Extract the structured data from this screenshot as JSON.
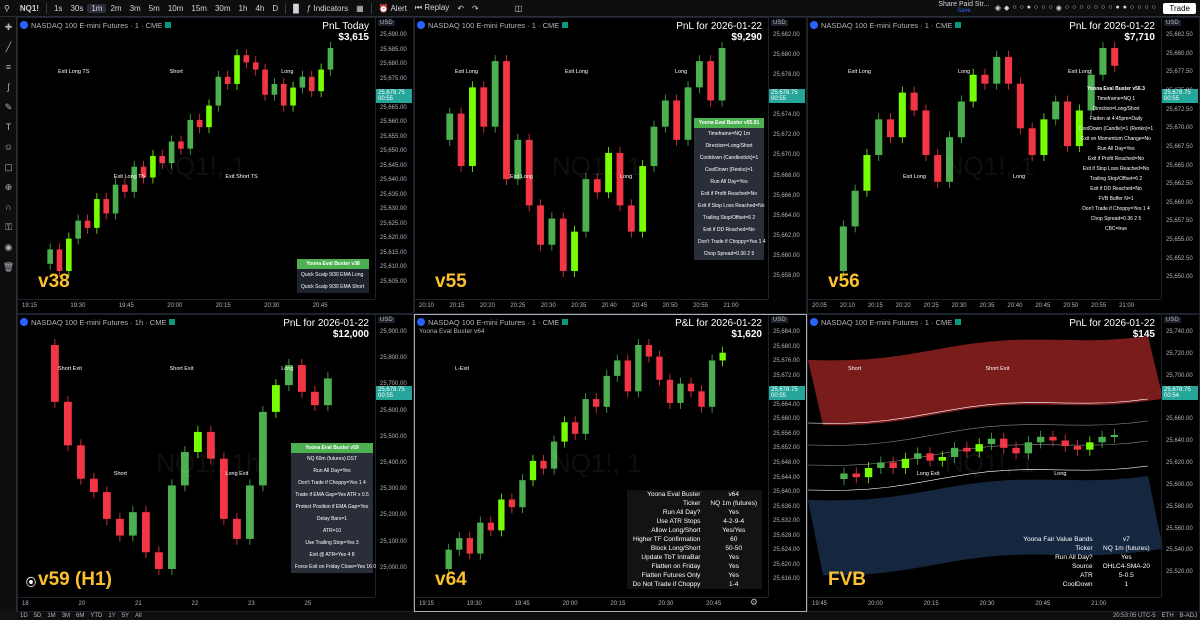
{
  "toolbar": {
    "symbol": "NQ1!",
    "intervals": [
      "1s",
      "30s",
      "1m",
      "2m",
      "3m",
      "5m",
      "10m",
      "15m",
      "30m",
      "1h",
      "4h",
      "D"
    ],
    "active_interval": "1m",
    "indicators": "Indicators",
    "alert": "Alert",
    "replay": "Replay",
    "share_line1": "Share Paid Str...",
    "share_line2": "Save",
    "trade": "Trade"
  },
  "bottom": {
    "ranges": [
      "1D",
      "5D",
      "1M",
      "3M",
      "6M",
      "YTD",
      "1Y",
      "5Y",
      "All"
    ],
    "clock": "20:53:05 UTC-5",
    "session": "ETH",
    "adj": "B-ADJ"
  },
  "panels": [
    {
      "id": "p1",
      "title": "NASDAQ 100 E-mini Futures · 1 · CME",
      "currency": "USD",
      "pnl_label": "PnL Today",
      "pnl_value": "$3,615",
      "version": "v38",
      "watermark": "NQ1!, 1",
      "yticks": [
        "25,690.00",
        "25,685.00",
        "25,680.00",
        "25,675.00",
        "25,670.00",
        "25,665.00",
        "25,660.00",
        "25,655.00",
        "25,650.00",
        "25,645.00",
        "25,640.00",
        "25,635.00",
        "25,630.00",
        "25,625.00",
        "25,620.00",
        "25,615.00",
        "25,610.00",
        "25,605.00"
      ],
      "price": "25,678.75",
      "countdown": "00:55",
      "xticks": [
        "19:15",
        "19:30",
        "19:45",
        "20:00",
        "20:15",
        "20:30",
        "20:45"
      ],
      "table": {
        "header": "Yoona Eval Buster v38",
        "rows": [
          "Quick Scalp 9/30 EMA Long",
          "Quick Scalp 9/30 EMA Short"
        ]
      },
      "labels": [
        {
          "t": "Exit Long TS",
          "k": "exit"
        },
        {
          "t": "Exit Long TS",
          "k": "exit"
        },
        {
          "t": "Short",
          "k": "short"
        },
        {
          "t": "Exit Short TS",
          "k": "exit"
        },
        {
          "t": "Long",
          "k": "long"
        }
      ]
    },
    {
      "id": "p2",
      "title": "NASDAQ 100 E-mini Futures · 1 · CME",
      "currency": "USD",
      "pnl_label": "PnL for 2026-01-22",
      "pnl_value": "$9,290",
      "version": "v55",
      "watermark": "NQ1!, 1",
      "yticks": [
        "25,682.00",
        "25,680.00",
        "25,678.00",
        "25,676.00",
        "25,674.00",
        "25,672.00",
        "25,670.00",
        "25,668.00",
        "25,666.00",
        "25,664.00",
        "25,662.00",
        "25,660.00",
        "25,658.00"
      ],
      "price": "25,678.75",
      "countdown": "00:55",
      "xticks": [
        "20:10",
        "20:15",
        "20:20",
        "20:25",
        "20:30",
        "20:35",
        "20:40",
        "20:45",
        "20:50",
        "20:55",
        "21:00"
      ],
      "table": {
        "header": "Yoona Eval Buster v55.91",
        "rows": [
          "Timeframe=NQ 1m",
          "Direction=Long/Short",
          "Cooldown (Candlestick)=1",
          "CoolDown (Renko)=1",
          "Run All Day=Yes",
          "Exit if Profit Reached=No",
          "Exit if Stop Loss Reached=No",
          "Trailing Stop/Offset=6 2",
          "Exit if DD Reached=No",
          "Don't Trade if Choppy=Yes 1 4",
          "Chop Spread=0.36 2 5"
        ]
      },
      "labels": [
        {
          "t": "Exit Long",
          "k": "exit"
        },
        {
          "t": "Exit Long",
          "k": "exit"
        },
        {
          "t": "Exit Long",
          "k": "exit"
        },
        {
          "t": "Long",
          "k": "long"
        },
        {
          "t": "Long",
          "k": "long"
        }
      ]
    },
    {
      "id": "p3",
      "title": "NASDAQ 100 E-mini Futures · 1 · CME",
      "currency": "USD",
      "pnl_label": "PnL for 2026-01-22",
      "pnl_value": "$7,710",
      "version": "v56",
      "watermark": "NQ1!, 1",
      "yticks": [
        "25,682.50",
        "25,680.00",
        "25,677.50",
        "25,675.00",
        "25,672.50",
        "25,670.00",
        "25,667.50",
        "25,665.00",
        "25,662.50",
        "25,660.00",
        "25,657.50",
        "25,655.00",
        "25,652.50",
        "25,650.00"
      ],
      "price": "25,678.75",
      "countdown": "00:55",
      "xticks": [
        "20:05",
        "20:10",
        "20:15",
        "20:20",
        "20:25",
        "20:30",
        "20:35",
        "20:40",
        "20:45",
        "20:50",
        "20:55",
        "21:00"
      ],
      "table": {
        "header": "Yoona Eval Buster v56.3",
        "rows": [
          "Timeframe=NQ 1",
          "Direction=Long/Short",
          "Flatten at 4:45pm=Daily",
          "CoolDown (Candle)=1 (Renko)=1",
          "Exit on Momentum Change=No",
          "Run All Day=Yes",
          "Exit if Profit Reached=No",
          "Exit if Stop Loss Reached=No",
          "Trailing Stop/Offset=6 2",
          "Exit if DD Reached=No",
          "FVB Buffer N=1",
          "Don't Trade if Choppy=Yes 1 4",
          "Chop Spread=0.36 2 5",
          "CBC=true"
        ]
      },
      "labels": [
        {
          "t": "Exit Long",
          "k": "exit"
        },
        {
          "t": "Exit Long",
          "k": "exit"
        },
        {
          "t": "Long",
          "k": "long"
        },
        {
          "t": "Long",
          "k": "long"
        },
        {
          "t": "Exit Long",
          "k": "exit"
        }
      ]
    },
    {
      "id": "p4",
      "title": "NASDAQ 100 E-mini Futures · 1h · CME",
      "currency": "USD",
      "pnl_label": "PnL for 2026-01-22",
      "pnl_value": "$12,000",
      "version": "v59 (H1)",
      "watermark": "NQ1!, 1h",
      "yticks": [
        "25,900.00",
        "25,800.00",
        "25,700.00",
        "25,600.00",
        "25,500.00",
        "25,400.00",
        "25,300.00",
        "25,200.00",
        "25,100.00",
        "25,000.00"
      ],
      "price": "25,678.75",
      "countdown": "00:55",
      "xticks": [
        "18",
        "20",
        "21",
        "22",
        "23",
        "25"
      ],
      "table": {
        "header": "Yoona Eval Buster v59",
        "rows": [
          "NQ 60m (futures) DST",
          "Run All Day=Yes",
          "Don't Trade if Choppy=Yes 1 4",
          "Trade if EMA Gap=Yes ATR x 0.5",
          "Protect Position if EMA Gap=Yes",
          "Delay Bars=1",
          "ATR=10",
          "Use Trailing Stop=Yes 3",
          "Exit @ ATR=Yes 4 8",
          "Force Exit on Friday Close=Yes 16 0"
        ]
      },
      "labels": [
        {
          "t": "Short Exit",
          "k": "exit"
        },
        {
          "t": "Short",
          "k": "short"
        },
        {
          "t": "Short Exit",
          "k": "exit"
        },
        {
          "t": "Long Exit",
          "k": "exit"
        },
        {
          "t": "Long",
          "k": "long"
        }
      ]
    },
    {
      "id": "p5",
      "title": "NASDAQ 100 E-mini Futures · 1 · CME",
      "subtitle": "Yoona Eval Buster v64",
      "currency": "USD",
      "pnl_label": "P&L for 2026-01-22",
      "pnl_value": "$1,620",
      "version": "v64",
      "watermark": "NQ1!, 1",
      "yticks": [
        "25,684.00",
        "25,680.00",
        "25,676.00",
        "25,672.00",
        "25,668.00",
        "25,664.00",
        "25,660.00",
        "25,656.00",
        "25,652.00",
        "25,648.00",
        "25,644.00",
        "25,640.00",
        "25,636.00",
        "25,632.00",
        "25,628.00",
        "25,624.00",
        "25,620.00",
        "25,616.00"
      ],
      "price": "25,678.75",
      "countdown": "00:55",
      "xticks": [
        "19:15",
        "19:30",
        "19:45",
        "20:00",
        "20:15",
        "20:30",
        "20:45"
      ],
      "kv": [
        [
          "Yoona Eval Buster",
          "v64"
        ],
        [
          "Ticker",
          "NQ 1m (futures)"
        ],
        [
          "Run All Day?",
          "Yes"
        ],
        [
          "Use ATR Stops",
          "4-2-9-4"
        ],
        [
          "Allow Long/Short",
          "Yes/Yes"
        ],
        [
          "Higher TF Confirmation",
          "60"
        ],
        [
          "Block Long/Short",
          "50-50"
        ],
        [
          "Update TbT IntraBar",
          "Yes"
        ],
        [
          "Flatten on Friday",
          "Yes"
        ],
        [
          "Flatten Futures Only",
          "Yes"
        ],
        [
          "Do Not Trade if Choppy",
          "1-4"
        ]
      ],
      "labels": [
        {
          "t": "L-Exit",
          "k": "exit"
        }
      ]
    },
    {
      "id": "p6",
      "title": "NASDAQ 100 E-mini Futures · 1 · CME",
      "currency": "USD",
      "pnl_label": "PnL for 2026-01-22",
      "pnl_value": "$145",
      "version": "FVB",
      "watermark": "NQ1!, 1",
      "yticks": [
        "25,740.00",
        "25,720.00",
        "25,700.00",
        "25,680.00",
        "25,660.00",
        "25,640.00",
        "25,620.00",
        "25,600.00",
        "25,580.00",
        "25,560.00",
        "25,540.00",
        "25,520.00"
      ],
      "price": "25,678.75",
      "countdown": "00:54",
      "xticks": [
        "19:45",
        "20:00",
        "20:15",
        "20:30",
        "20:45",
        "21:00"
      ],
      "kv": [
        [
          "Yoona Fair Value Bands",
          "v7"
        ],
        [
          "Ticker",
          "NQ 1m (futures)"
        ],
        [
          "Run All Day?",
          "Yes"
        ],
        [
          "Source",
          "OHLC4-SMA-20"
        ],
        [
          "ATR",
          "5-0.5"
        ],
        [
          "CoolDown",
          "1"
        ]
      ],
      "labels": [
        {
          "t": "Short",
          "k": "short"
        },
        {
          "t": "Long Exit",
          "k": "exit"
        },
        {
          "t": "Short Exit",
          "k": "exit"
        },
        {
          "t": "Long",
          "k": "long"
        }
      ]
    }
  ],
  "colors": {
    "up": "#4caf50",
    "up2": "#76ff03",
    "down": "#f23645",
    "bg": "#000000",
    "accent": "#fbc02d",
    "long": "#2962ff",
    "short": "#e040fb"
  },
  "chart_data": [
    {
      "type": "candlestick",
      "panel": "v38",
      "series": [
        {
          "name": "NQ1!, 1",
          "values": [
            25618,
            25622,
            25616,
            25625,
            25630,
            25628,
            25636,
            25632,
            25640,
            25638,
            25645,
            25642,
            25648,
            25646,
            25652,
            25650,
            25658,
            25656,
            25662,
            25670,
            25668,
            25676,
            25674,
            25672,
            25665,
            25668,
            25662,
            25667,
            25670,
            25666,
            25672,
            25678
          ]
        }
      ]
    },
    {
      "type": "candlestick",
      "panel": "v55",
      "series": [
        {
          "name": "NQ1!, 1",
          "values": [
            25671,
            25673,
            25669,
            25675,
            25672,
            25677,
            25668,
            25671,
            25666,
            25663,
            25665,
            25661,
            25664,
            25668,
            25667,
            25670,
            25666,
            25664,
            25669,
            25672,
            25674,
            25671,
            25675,
            25677,
            25674,
            25678
          ]
        }
      ]
    },
    {
      "type": "candlestick",
      "panel": "v56",
      "series": [
        {
          "name": "NQ1!, 1",
          "values": [
            25655,
            25660,
            25664,
            25668,
            25672,
            25670,
            25675,
            25673,
            25668,
            25665,
            25670,
            25674,
            25677,
            25676,
            25679,
            25676,
            25671,
            25668,
            25672,
            25674,
            25669,
            25673,
            25677,
            25680,
            25678
          ]
        }
      ]
    },
    {
      "type": "candlestick",
      "panel": "v59 (H1)",
      "series": [
        {
          "name": "NQ1!, 1h",
          "values": [
            25820,
            25650,
            25520,
            25420,
            25380,
            25300,
            25250,
            25320,
            25200,
            25150,
            25400,
            25500,
            25560,
            25480,
            25300,
            25240,
            25400,
            25620,
            25700,
            25760,
            25680,
            25640,
            25720
          ]
        }
      ]
    },
    {
      "type": "candlestick",
      "panel": "v64",
      "series": [
        {
          "name": "NQ1!, 1",
          "values": [
            25622,
            25627,
            25630,
            25626,
            25634,
            25632,
            25640,
            25638,
            25645,
            25650,
            25648,
            25655,
            25660,
            25657,
            25666,
            25664,
            25672,
            25676,
            25668,
            25680,
            25677,
            25671,
            25665,
            25670,
            25668,
            25664,
            25676,
            25678
          ]
        }
      ]
    },
    {
      "type": "candlestick",
      "panel": "FVB",
      "series": [
        {
          "name": "NQ1!, 1",
          "values": [
            25654,
            25657,
            25655,
            25660,
            25663,
            25660,
            25665,
            25668,
            25664,
            25666,
            25671,
            25669,
            25673,
            25676,
            25671,
            25668,
            25674,
            25677,
            25675,
            25672,
            25670,
            25674,
            25677,
            25678
          ]
        }
      ]
    }
  ]
}
